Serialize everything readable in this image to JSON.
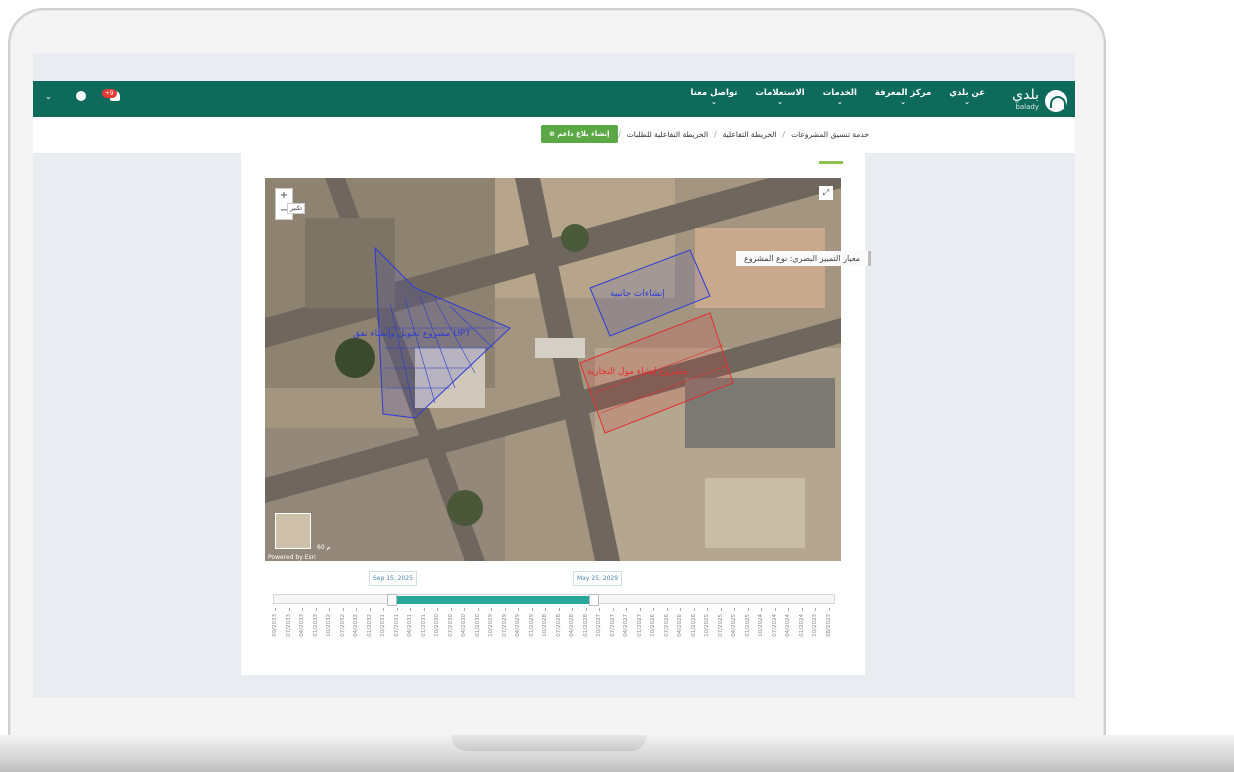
{
  "nav": {
    "logo_text": "بلدي",
    "logo_sub": "balady",
    "items": [
      {
        "label": "عن بلدي"
      },
      {
        "label": "مركز المعرفة"
      },
      {
        "label": "الخدمات"
      },
      {
        "label": "الاستعلامات"
      },
      {
        "label": "تواصل معنا"
      }
    ],
    "notification_count": "+9"
  },
  "breadcrumb": {
    "items": [
      "خدمة تنسيق المشروعات",
      "الخريطة التفاعلية",
      "الخريطة التفاعلية للطلبات"
    ],
    "create_button": "إنشاء بلاغ داعم"
  },
  "map": {
    "zoom_in": "+",
    "zoom_out": "−",
    "zoom_tooltip": "تكبير",
    "attribution": "Powered by Esri",
    "scale_label": "60 م",
    "projects": [
      {
        "label": "مشروع تحويل وإنشاء نفق UPT",
        "color": "#2d3bd6"
      },
      {
        "label": "إنشاءات جانبية",
        "color": "#2d3bd6"
      },
      {
        "label": "مشروع إنشاء مول التجارية",
        "color": "#e32d2d"
      }
    ]
  },
  "timeline": {
    "start_label": "Sep 15, 2025",
    "end_label": "May 25, 2029",
    "ticks": [
      "08/2023",
      "10/2023",
      "01/2024",
      "04/2024",
      "07/2024",
      "10/2024",
      "01/2025",
      "04/2025",
      "07/2025",
      "10/2025",
      "01/2026",
      "04/2026",
      "07/2026",
      "10/2026",
      "01/2027",
      "04/2027",
      "07/2027",
      "10/2027",
      "01/2028",
      "04/2028",
      "07/2028",
      "10/2028",
      "01/2029",
      "04/2029",
      "07/2029",
      "10/2029",
      "01/2030",
      "04/2030",
      "07/2030",
      "10/2030",
      "01/2031",
      "04/2031",
      "07/2031",
      "10/2031",
      "01/2032",
      "04/2032",
      "07/2032",
      "10/2032",
      "01/2033",
      "04/2033",
      "07/2033",
      "09/2033"
    ]
  },
  "criteria": "معيار التمييز البصري: نوع المشروع"
}
